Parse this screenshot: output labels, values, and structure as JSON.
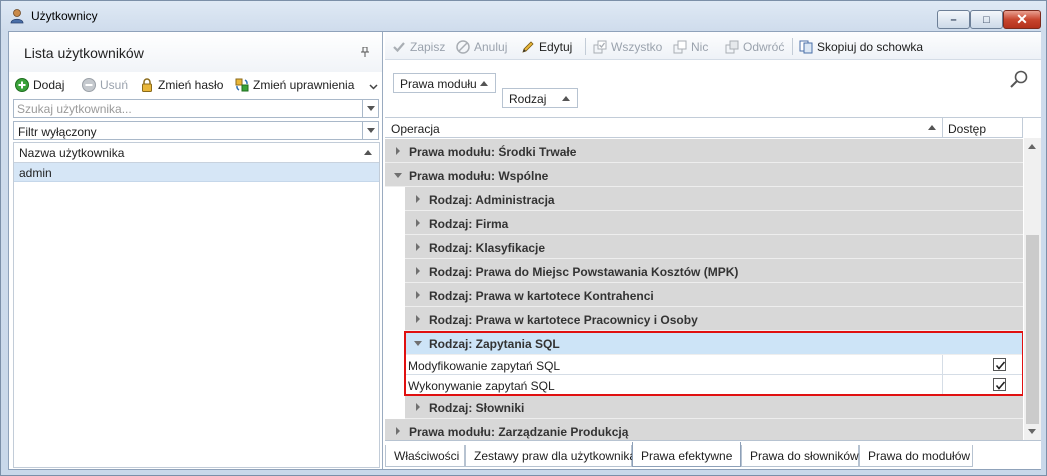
{
  "window": {
    "title": "Użytkownicy"
  },
  "users_panel": {
    "title": "Lista użytkowników",
    "toolbar": {
      "add": "Dodaj",
      "remove": "Usuń",
      "change_password": "Zmień hasło",
      "change_permissions": "Zmień uprawnienia"
    },
    "search_placeholder": "Szukaj użytkownika...",
    "filter_value": "Filtr wyłączony",
    "column_header": "Nazwa użytkownika",
    "rows": [
      "admin"
    ]
  },
  "permissions_panel": {
    "toolbar": {
      "save": "Zapisz",
      "cancel": "Anuluj",
      "edit": "Edytuj",
      "all": "Wszystko",
      "none": "Nic",
      "invert": "Odwróć",
      "copy": "Skopiuj do schowka"
    },
    "group_chips": [
      "Prawa modułu",
      "Rodzaj"
    ],
    "columns": {
      "operation": "Operacja",
      "access": "Dostęp"
    },
    "rows": [
      {
        "kind": "module",
        "label": "Prawa modułu: Środki Trwałe",
        "expanded": false
      },
      {
        "kind": "module",
        "label": "Prawa modułu: Wspólne",
        "expanded": true
      },
      {
        "kind": "group",
        "label": "Rodzaj: Administracja",
        "expanded": false
      },
      {
        "kind": "group",
        "label": "Rodzaj: Firma",
        "expanded": false
      },
      {
        "kind": "group",
        "label": "Rodzaj: Klasyfikacje",
        "expanded": false
      },
      {
        "kind": "group",
        "label": "Rodzaj: Prawa do Miejsc Powstawania Kosztów (MPK)",
        "expanded": false
      },
      {
        "kind": "group",
        "label": "Rodzaj: Prawa w kartotece Kontrahenci",
        "expanded": false
      },
      {
        "kind": "group",
        "label": "Rodzaj: Prawa w kartotece Pracownicy i Osoby",
        "expanded": false
      },
      {
        "kind": "group",
        "label": "Rodzaj: Zapytania SQL",
        "expanded": true,
        "selected": true
      },
      {
        "kind": "leaf",
        "label": "Modyfikowanie zapytań SQL",
        "checked": true
      },
      {
        "kind": "leaf",
        "label": "Wykonywanie zapytań SQL",
        "checked": true
      },
      {
        "kind": "group",
        "label": "Rodzaj: Słowniki",
        "expanded": false
      },
      {
        "kind": "module",
        "label": "Prawa modułu: Zarządzanie Produkcją",
        "expanded": false
      }
    ],
    "tabs": [
      "Właściwości",
      "Zestawy praw dla użytkownika",
      "Prawa efektywne",
      "Prawa do słowników",
      "Prawa do modułów"
    ],
    "active_tab": "Prawa efektywne"
  },
  "colors": {
    "highlight_border": "#e01010",
    "selected_row": "#cde4f7",
    "group_row": "#d8d8d8",
    "user_row_selected": "#d6e6f6"
  }
}
